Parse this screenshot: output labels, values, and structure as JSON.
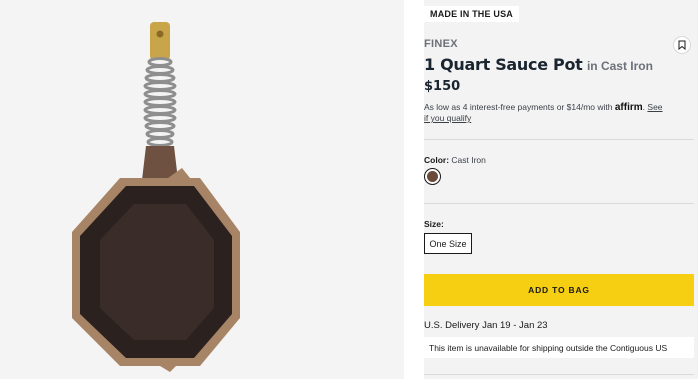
{
  "product": {
    "badge": "MADE IN THE USA",
    "brand": "FINEX",
    "title": "1 Quart Sauce Pot",
    "subtitle": "in Cast Iron",
    "price": "$150",
    "financing": {
      "text": "As low as 4 interest-free payments or $14/mo with ",
      "brand": "affirm",
      "link": "See if you qualify"
    }
  },
  "color": {
    "label": "Color:",
    "value": "Cast Iron",
    "swatch_color": "#6a4a3a"
  },
  "size": {
    "label": "Size:",
    "option": "One Size"
  },
  "actions": {
    "add_to_bag": "ADD TO BAG",
    "button_color": "#f6cf13"
  },
  "shipping": {
    "delivery": "U.S. Delivery Jan 19 - Jan 23",
    "notice": "This item is unavailable for shipping outside the Contiguous US"
  },
  "icons": {
    "bookmark": "bookmark-icon"
  }
}
